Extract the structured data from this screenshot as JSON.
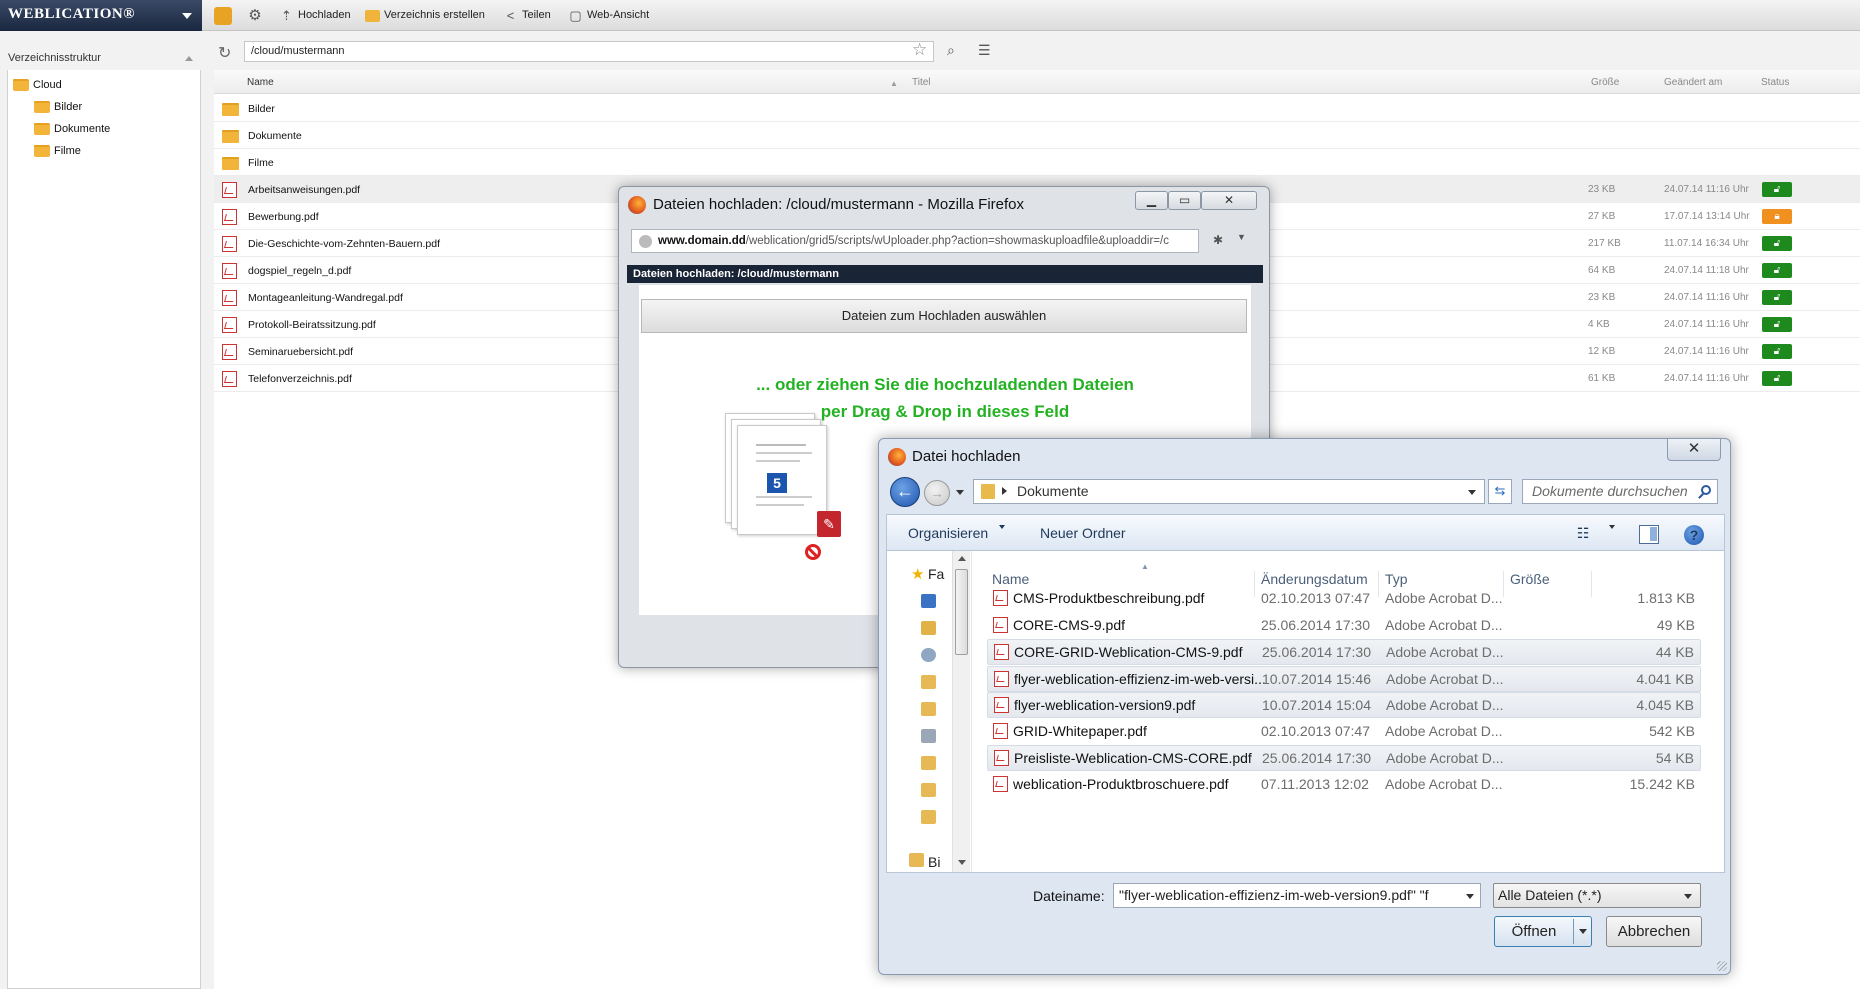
{
  "app": {
    "logo": "WEBLICATION®",
    "toolbar": {
      "upload": "Hochladen",
      "create_dir": "Verzeichnis erstellen",
      "share": "Teilen",
      "web_view": "Web-Ansicht"
    }
  },
  "sidebar": {
    "title": "Verzeichnisstruktur",
    "tree": {
      "root": "Cloud",
      "children": [
        "Bilder",
        "Dokumente",
        "Filme"
      ]
    }
  },
  "addressbar": {
    "path": "/cloud/mustermann"
  },
  "grid": {
    "headers": {
      "name": "Name",
      "title": "Titel",
      "size": "Größe",
      "modified": "Geändert am",
      "status": "Status"
    },
    "folders": [
      "Bilder",
      "Dokumente",
      "Filme"
    ],
    "files": [
      {
        "name": "Arbeitsanweisungen.pdf",
        "size": "23 KB",
        "date": "24.07.14 11:16 Uhr",
        "status": "unlocked",
        "status_color": "#1e8a1e"
      },
      {
        "name": "Bewerbung.pdf",
        "size": "27 KB",
        "date": "17.07.14 13:14 Uhr",
        "status": "locked",
        "status_color": "#f0901e"
      },
      {
        "name": "Die-Geschichte-vom-Zehnten-Bauern.pdf",
        "size": "217 KB",
        "date": "11.07.14 16:34 Uhr",
        "status": "unlocked",
        "status_color": "#1e8a1e"
      },
      {
        "name": "dogspiel_regeln_d.pdf",
        "size": "64 KB",
        "date": "24.07.14 11:18 Uhr",
        "status": "unlocked",
        "status_color": "#1e8a1e"
      },
      {
        "name": "Montageanleitung-Wandregal.pdf",
        "size": "23 KB",
        "date": "24.07.14 11:16 Uhr",
        "status": "unlocked",
        "status_color": "#1e8a1e"
      },
      {
        "name": "Protokoll-Beiratssitzung.pdf",
        "size": "4 KB",
        "date": "24.07.14 11:16 Uhr",
        "status": "unlocked",
        "status_color": "#1e8a1e"
      },
      {
        "name": "Seminaruebersicht.pdf",
        "size": "12 KB",
        "date": "24.07.14 11:16 Uhr",
        "status": "unlocked",
        "status_color": "#1e8a1e"
      },
      {
        "name": "Telefonverzeichnis.pdf",
        "size": "61 KB",
        "date": "24.07.14 11:16 Uhr",
        "status": "unlocked",
        "status_color": "#1e8a1e"
      }
    ]
  },
  "firefox_window": {
    "title": "Dateien hochladen: /cloud/mustermann - Mozilla Firefox",
    "url_domain": "www.domain.dd",
    "url_rest": "/weblication/grid5/scripts/wUploader.php?action=showmaskuploadfile&uploaddir=/c",
    "header_bar": "Dateien hochladen: /cloud/mustermann",
    "choose_button": "Dateien zum Hochladen auswählen",
    "drop_line1": "... oder ziehen Sie die hochzuladenden Dateien",
    "drop_line2": "per Drag & Drop in dieses Feld",
    "badge": "5"
  },
  "file_dialog": {
    "title": "Datei hochladen",
    "location": "Dokumente",
    "search_placeholder": "Dokumente durchsuchen",
    "organize": "Organisieren",
    "new_folder": "Neuer Ordner",
    "nav_first_label": "Fa",
    "nav_last_label": "Bi",
    "columns": {
      "name": "Name",
      "date": "Änderungsdatum",
      "type": "Typ",
      "size": "Größe"
    },
    "files": [
      {
        "name": "CMS-Produktbeschreibung.pdf",
        "date": "02.10.2013 07:47",
        "type": "Adobe Acrobat D...",
        "size": "1.813 KB",
        "selected": false
      },
      {
        "name": "CORE-CMS-9.pdf",
        "date": "25.06.2014 17:30",
        "type": "Adobe Acrobat D...",
        "size": "49 KB",
        "selected": false
      },
      {
        "name": "CORE-GRID-Weblication-CMS-9.pdf",
        "date": "25.06.2014 17:30",
        "type": "Adobe Acrobat D...",
        "size": "44 KB",
        "selected": true
      },
      {
        "name": "flyer-weblication-effizienz-im-web-versi...",
        "date": "10.07.2014 15:46",
        "type": "Adobe Acrobat D...",
        "size": "4.041 KB",
        "selected": true
      },
      {
        "name": "flyer-weblication-version9.pdf",
        "date": "10.07.2014 15:04",
        "type": "Adobe Acrobat D...",
        "size": "4.045 KB",
        "selected": true
      },
      {
        "name": "GRID-Whitepaper.pdf",
        "date": "02.10.2013 07:47",
        "type": "Adobe Acrobat D...",
        "size": "542 KB",
        "selected": false
      },
      {
        "name": "Preisliste-Weblication-CMS-CORE.pdf",
        "date": "25.06.2014 17:30",
        "type": "Adobe Acrobat D...",
        "size": "54 KB",
        "selected": true
      },
      {
        "name": "weblication-Produktbroschuere.pdf",
        "date": "07.11.2013 12:02",
        "type": "Adobe Acrobat D...",
        "size": "15.242 KB",
        "selected": false
      }
    ],
    "filename_label": "Dateiname:",
    "filename_value": "\"flyer-weblication-effizienz-im-web-version9.pdf\" \"f",
    "filter": "Alle Dateien (*.*)",
    "open_button": "Öffnen",
    "cancel_button": "Abbrechen"
  }
}
